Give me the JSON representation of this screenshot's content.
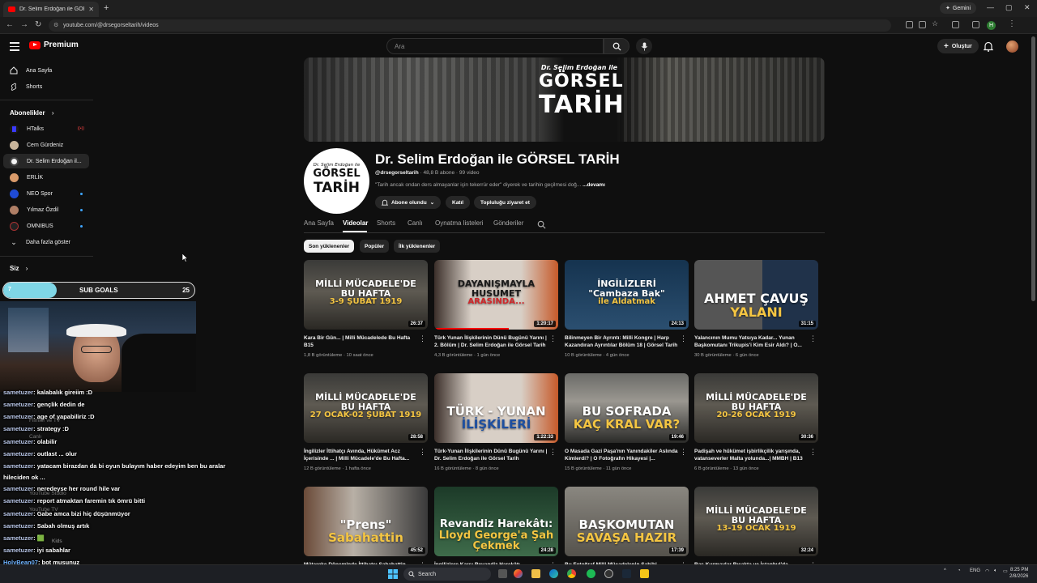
{
  "browser": {
    "tab_title": "Dr. Selim Erdoğan ile GÖRSEL T",
    "new_tab": "+",
    "gemini_label": "Gemini",
    "url": "youtube.com/@drsegorseltarih/videos",
    "profile_initial": "H",
    "window_controls": [
      "—",
      "▢",
      "✕"
    ]
  },
  "header": {
    "logo": "Premium",
    "search_placeholder": "Ara",
    "create_label": "Oluştur"
  },
  "sidebar": {
    "main": [
      {
        "label": "Ana Sayfa",
        "icon": "home-icon"
      },
      {
        "label": "Shorts",
        "icon": "shorts-icon"
      }
    ],
    "subscriptions_heading": "Abonelikler",
    "subscriptions": [
      {
        "label": "HTalks",
        "color": "#3a3aff",
        "badge": "live"
      },
      {
        "label": "Cem Gürdeniz",
        "color": "#c8b49a",
        "badge": "none"
      },
      {
        "label": "Dr. Selim Erdoğan il...",
        "color": "#f2f2f2",
        "badge": "none",
        "active": true
      },
      {
        "label": "ERLİK",
        "color": "#d89a6a",
        "badge": "none"
      },
      {
        "label": "NEO Spor",
        "color": "#1f4bd6",
        "badge": "dot"
      },
      {
        "label": "Yılmaz Özdil",
        "color": "#b07f66",
        "badge": "dot"
      },
      {
        "label": "OMNIBUS",
        "color": "#222222",
        "badge": "dot"
      }
    ],
    "show_more": "Daha fazla göster",
    "you_heading": "Siz",
    "hidden_items": [
      "Filmler ve TV",
      "Canlı",
      "YouTube Studio",
      "YouTube TV",
      "Kids"
    ]
  },
  "stream": {
    "sub_goals_label": "SUB GOALS",
    "sub_goal_current": "7",
    "sub_goal_target": "25",
    "sub_goal_fraction": 0.28,
    "chat": [
      {
        "user": "sametuzer",
        "msg": ": kalabalık gireiim :D"
      },
      {
        "user": "sametuzer",
        "msg": ": gençlik dedin de"
      },
      {
        "user": "sametuzer",
        "msg": ": age of yapabiliriz :D"
      },
      {
        "user": "sametuzer",
        "msg": ": strategy :D"
      },
      {
        "user": "sametuzer",
        "msg": ": olabilir"
      },
      {
        "user": "sametuzer",
        "msg": ": outlast ... olur"
      },
      {
        "user": "sametuzer",
        "msg": ": yatacam birazdan da bi oyun bulayım haber edeyim ben bu aralar"
      },
      {
        "user": "",
        "msg": "hileciden ok ..."
      },
      {
        "user": "sametuzer",
        "msg": ": neredeyse her round hile var"
      },
      {
        "user": "sametuzer",
        "msg": ": report atmaktan faremin tık ömrü bitti"
      },
      {
        "user": "sametuzer",
        "msg": ": Gabe amca bizi hiç düşünmüyor"
      },
      {
        "user": "sametuzer",
        "msg": ": Sabah olmuş artık"
      },
      {
        "user": "sametuzer",
        "msg": ": 🟩"
      },
      {
        "user": "sametuzer",
        "msg": ": iyi sabahlar"
      },
      {
        "user": "HolyBean07",
        "msg": ": bot musunuz"
      },
      {
        "user": "ertgrldmrdzn",
        "msg": ": hadi kanka rush cs"
      }
    ]
  },
  "banner": {
    "line1": "Dr. Selim Erdoğan ile",
    "line2": "GÖRSEL",
    "line3": "TARİH"
  },
  "channel": {
    "avatar_line1": "Dr. Selim Erdoğan ile",
    "avatar_line2": "GÖRSEL",
    "avatar_line3": "TARİH",
    "name": "Dr. Selim Erdoğan ile GÖRSEL TARİH",
    "handle": "@drsegorseltarih",
    "stats": "· 48,8 B abone · 99 video",
    "description": "\"Tarih ancak ondan ders almayanlar için tekerrür eder\" diyerek ve tarihin geçilmesi doğ...",
    "more": "...devamı",
    "subscribed_label": "Abone olundu",
    "join_label": "Katıl",
    "community_label": "Topluluğu ziyaret et"
  },
  "tabs": [
    "Ana Sayfa",
    "Videolar",
    "Shorts",
    "Canlı",
    "Oynatma listeleri",
    "Gönderiler"
  ],
  "active_tab": "Videolar",
  "chips": [
    "Son yüklenenler",
    "Popüler",
    "İlk yüklenenler"
  ],
  "videos": [
    {
      "thumb_text": "MİLLİ MÜCADELE'DE\nBU HAFTA\n3-9 ŞUBAT 1919",
      "duration": "26:37",
      "title": "Kara Bir Gün... | Milli Mücadelede Bu Hafta B15",
      "meta": "1,8 B görüntüleme · 10 saat önce"
    },
    {
      "thumb_text": "DAYANIŞMAYLA\nHUSUMET\nARASINDA...",
      "duration": "1:20:17",
      "title": "Türk Yunan İlişkilerinin Dünü Bugünü Yarını | 2. Bölüm | Dr. Selim Erdoğan ile Görsel Tarih",
      "meta": "4,3 B görüntüleme · 1 gün önce",
      "progress": 0.6
    },
    {
      "thumb_text": "İNGİLİZLERİ\n\"Cambaza Bak\"\nile Aldatmak",
      "duration": "24:13",
      "title": "Bilinmeyen Bir Ayrıntı: Milli Kongre | Harp Kazandıran Ayrıntılar Bölüm 18 | Görsel Tarih",
      "meta": "10 B görüntüleme · 4 gün önce"
    },
    {
      "thumb_text": "AHMET ÇAVUŞ\nYALANI",
      "duration": "31:15",
      "title": "Yalancının Mumu Yatsıya Kadar... Yunan Başkomutanı Trikupis'i Kim Esir Aldı? | O...",
      "meta": "30 B görüntüleme · 6 gün önce"
    },
    {
      "thumb_text": "MİLLİ MÜCADELE'DE\nBU HAFTA\n27 OCAK-02 ŞUBAT 1919",
      "duration": "28:58",
      "title": "İngilizler İttihatçı Avında, Hükümet Acz İçerisinde ... | Milli Mücadele'de Bu Hafta...",
      "meta": "12 B görüntüleme · 1 hafta önce"
    },
    {
      "thumb_text": "TÜRK - YUNAN\nİLİŞKİLERİ",
      "duration": "1:22:33",
      "title": "Türk-Yunan İlişkilerinin Dünü Bugünü Yarını | Dr. Selim Erdoğan ile Görsel Tarih",
      "meta": "16 B görüntüleme · 8 gün önce"
    },
    {
      "thumb_text": "BU SOFRADA\nKAÇ KRAL VAR?",
      "duration": "19:46",
      "title": "O Masada Gazi Paşa'nın Yanındakiler Aslında Kimlerdi? | O Fotoğrafın Hikayesi |...",
      "meta": "15 B görüntüleme · 11 gün önce"
    },
    {
      "thumb_text": "MİLLİ MÜCADELE'DE\nBU HAFTA\n20-26 OCAK 1919",
      "duration": "30:36",
      "title": "Padişah ve hükümet işbirlikçilik yarışında, vatanseverler Malta yolunda...| MMBH | B13",
      "meta": "6 B görüntüleme · 13 gün önce"
    },
    {
      "thumb_text": "\"Prens\"\nSabahattin",
      "duration": "45:52",
      "title": "Mütareke Döneminde İttihatçı Sabahattin...",
      "meta": ""
    },
    {
      "thumb_text": "Revandiz Harekâtı:\nLloyd George'a Şah Çekmek",
      "duration": "24:28",
      "title": "İngilizlere Karşı Revandiz Harekâtı...",
      "meta": ""
    },
    {
      "thumb_text": "BAŞKOMUTAN\nSAVAŞA HAZIR",
      "duration": "17:39",
      "title": "Bu Fotoğraf Milli Mücadelenin Sahibi...",
      "meta": ""
    },
    {
      "thumb_text": "MİLLİ MÜCADELE'DE\nBU HAFTA\n13-19 OCAK 1919",
      "duration": "32:24",
      "title": "Baş Kurmaylar Bıçakta ve İstanbul'da...",
      "meta": ""
    }
  ],
  "taskbar": {
    "search_label": "Search",
    "lang": "ENG",
    "time": "8:25 PM",
    "date": "2/8/2026"
  }
}
